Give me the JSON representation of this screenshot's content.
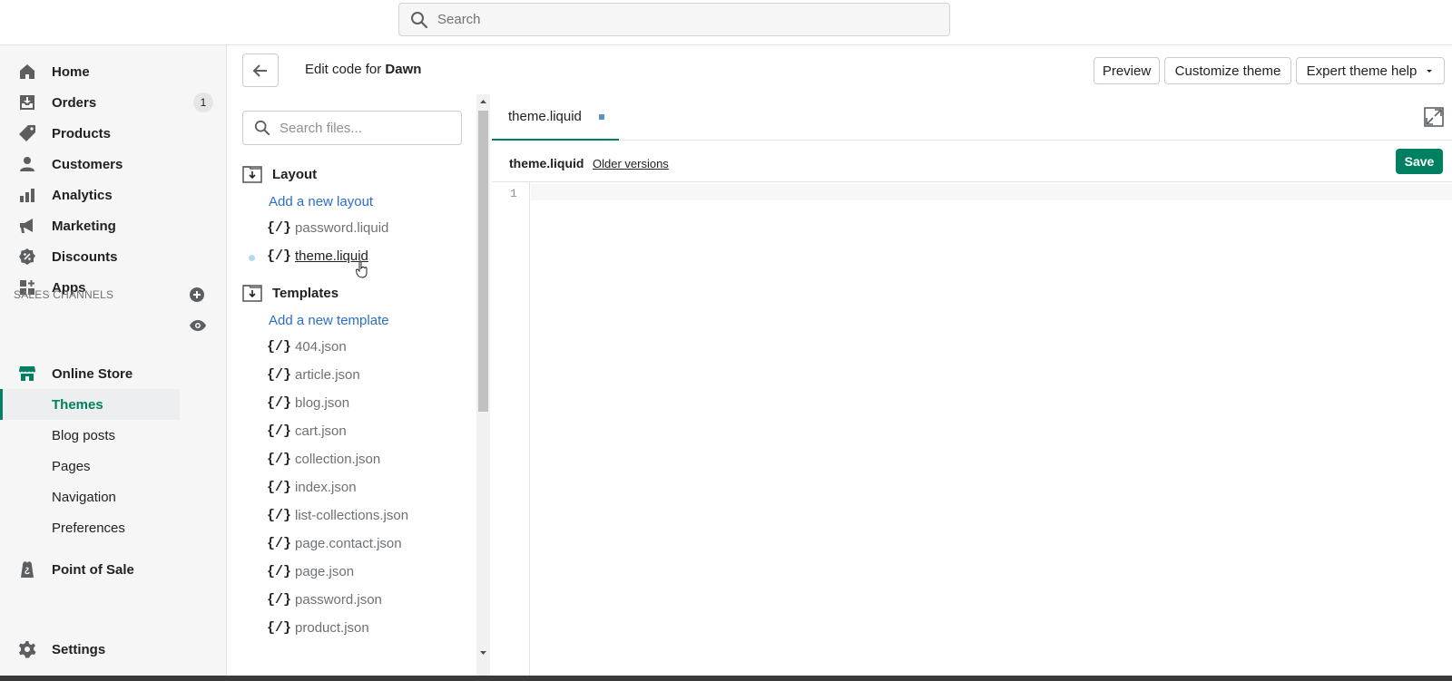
{
  "topbar": {
    "search_placeholder": "Search"
  },
  "sidebar": {
    "items": [
      {
        "label": "Home"
      },
      {
        "label": "Orders",
        "badge": "1"
      },
      {
        "label": "Products"
      },
      {
        "label": "Customers"
      },
      {
        "label": "Analytics"
      },
      {
        "label": "Marketing"
      },
      {
        "label": "Discounts"
      },
      {
        "label": "Apps"
      }
    ],
    "sales_channels_heading": "SALES CHANNELS",
    "online_store": "Online Store",
    "sub_items": [
      {
        "label": "Themes"
      },
      {
        "label": "Blog posts"
      },
      {
        "label": "Pages"
      },
      {
        "label": "Navigation"
      },
      {
        "label": "Preferences"
      }
    ],
    "point_of_sale": "Point of Sale",
    "settings": "Settings"
  },
  "header": {
    "edit_prefix": "Edit code for ",
    "theme_name": "Dawn",
    "preview": "Preview",
    "customize": "Customize theme",
    "expert": "Expert theme help"
  },
  "files": {
    "search_placeholder": "Search files...",
    "brace": "{/}",
    "layout_heading": "Layout",
    "add_layout": "Add a new layout",
    "layout_files": [
      "password.liquid",
      "theme.liquid"
    ],
    "templates_heading": "Templates",
    "add_template": "Add a new template",
    "template_files": [
      "404.json",
      "article.json",
      "blog.json",
      "cart.json",
      "collection.json",
      "index.json",
      "list-collections.json",
      "page.contact.json",
      "page.json",
      "password.json",
      "product.json"
    ]
  },
  "editor": {
    "tab_name": "theme.liquid",
    "file_name": "theme.liquid",
    "older_versions": "Older versions",
    "save": "Save",
    "line_number": "1"
  },
  "colors": {
    "accent": "#008060",
    "link": "#2c6ecb"
  },
  "icons": [
    "search-icon",
    "home-icon",
    "orders-icon",
    "products-icon",
    "customers-icon",
    "analytics-icon",
    "marketing-icon",
    "discounts-icon",
    "apps-icon",
    "add-channel-icon",
    "online-store-icon",
    "eye-icon",
    "point-of-sale-icon",
    "settings-icon",
    "back-arrow-icon",
    "folder-icon",
    "expand-icon"
  ]
}
